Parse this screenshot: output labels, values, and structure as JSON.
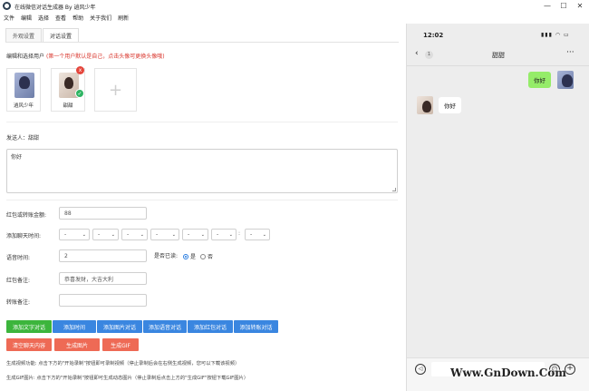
{
  "window": {
    "title": "在线微信对话生成器 By 逍风少年",
    "minimize": "—",
    "maximize": "☐",
    "close": "✕"
  },
  "menu": [
    "文件",
    "编辑",
    "选择",
    "查看",
    "帮助",
    "关于我们",
    "刷新"
  ],
  "tabs": [
    "外观设置",
    "对话设置"
  ],
  "active_tab": "对话设置",
  "users_section": {
    "title": "编辑和选择用户",
    "hint": "(第一个用户默认是自己，点击头像可更换头像哦)",
    "users": [
      {
        "name": "逍风少年",
        "selected": false
      },
      {
        "name": "甜甜",
        "selected": true
      }
    ],
    "delete_badge": "x",
    "check_badge": "✓",
    "add_symbol": "+"
  },
  "sender": "发送人：甜甜",
  "message_text": "你好",
  "form": {
    "red_packet_amount_label": "红包或转账金额:",
    "red_packet_amount": "88",
    "chat_time_label": "添加聊天时间:",
    "time_selects": [
      "-",
      "-",
      "-",
      "-",
      "-",
      "-",
      "-"
    ],
    "time_colon": ":",
    "voice_time_label": "语音时间:",
    "voice_time": "2",
    "read_label": "是否已读:",
    "read_yes": "是",
    "read_no": "否",
    "read_value": "是",
    "red_packet_note_label": "红包备注:",
    "red_packet_note": "恭喜发财，大吉大利",
    "transfer_note_label": "转账备注:",
    "transfer_note": ""
  },
  "buttons": {
    "add_text": "添加文字对话",
    "add_time": "添加时间",
    "add_image": "添加图片对话",
    "add_voice": "添加语音对话",
    "add_red_packet": "添加红包对话",
    "add_transfer": "添加转账对话",
    "clear_chat": "清空聊天内容",
    "generate_image": "生成图片",
    "generate_gif": "生成GIF"
  },
  "notes": [
    "生成视频功能: 点击下方的\"开始录制\"按钮即可录制视频（停止录制后会在右侧生成视频，您可以下载该视频）",
    "生成GIF图片: 点击下方的\"开始录制\"按钮即可生成动态图片（停止录制后点击上方的\"生成GIF\"按钮下载GIF图片）"
  ],
  "phone": {
    "time": "12:02",
    "status_icons": "▮▮▮ ◠ ▭",
    "back": "‹",
    "unread": "1",
    "title": "甜甜",
    "more": "···",
    "messages": [
      {
        "side": "right",
        "text": "你好"
      },
      {
        "side": "left",
        "text": "你好"
      }
    ],
    "voice_icon": "◁",
    "emoji_icon": "☺",
    "plus_icon": "+"
  },
  "watermark": "Www.GnDown.Com"
}
